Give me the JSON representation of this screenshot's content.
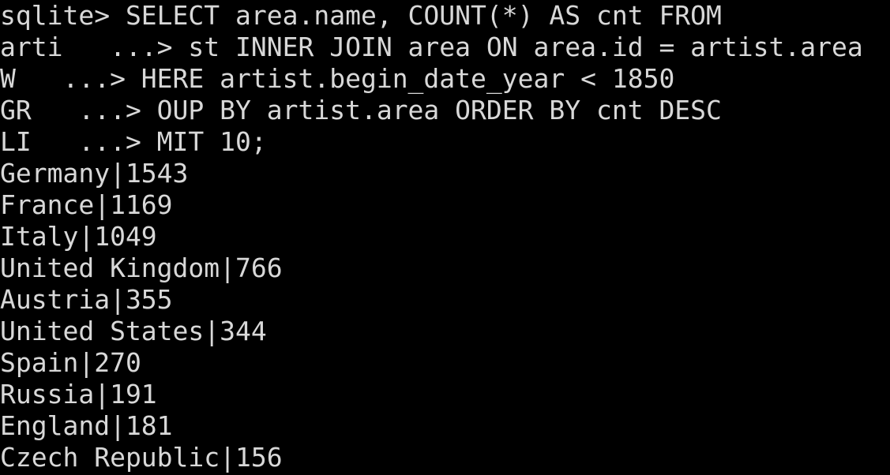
{
  "terminal": {
    "lines": [
      "sqlite> SELECT area.name, COUNT(*) AS cnt FROM",
      "arti   ...> st INNER JOIN area ON area.id = artist.area",
      "W   ...> HERE artist.begin_date_year < 1850",
      "GR   ...> OUP BY artist.area ORDER BY cnt DESC",
      "LI   ...> MIT 10;",
      "Germany|1543",
      "France|1169",
      "Italy|1049",
      "United Kingdom|766",
      "Austria|355",
      "United States|344",
      "Spain|270",
      "Russia|191",
      "England|181",
      "Czech Republic|156"
    ]
  },
  "colors": {
    "background": "#000000",
    "text": "#d8d8d8"
  }
}
